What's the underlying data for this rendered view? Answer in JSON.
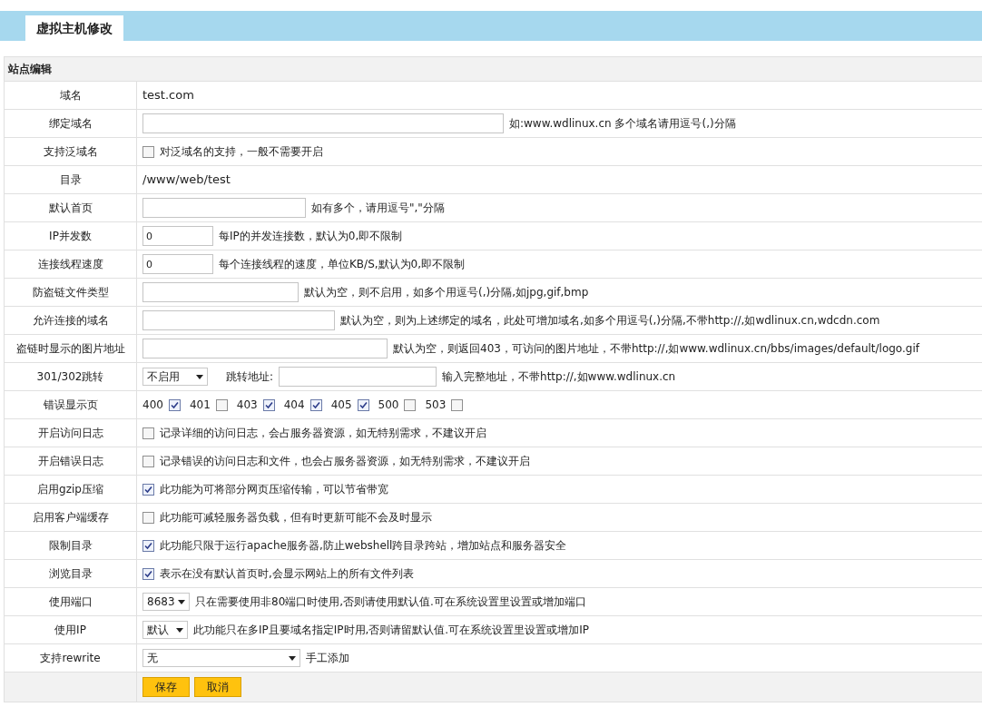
{
  "tab": {
    "label": "虚拟主机修改",
    "selected": true
  },
  "section": {
    "title": "站点编辑"
  },
  "rows": [
    {
      "kind": "text",
      "label": "域名",
      "value": "test.com"
    },
    {
      "kind": "input",
      "label": "绑定域名",
      "hint": "如:www.wdlinux.cn 多个域名请用逗号(,)分隔"
    },
    {
      "kind": "checkbox",
      "label": "支持泛域名",
      "checked": false,
      "hint": "对泛域名的支持，一般不需要开启"
    },
    {
      "kind": "text",
      "label": "目录",
      "value": "/www/web/test"
    },
    {
      "kind": "input",
      "label": "默认首页",
      "hint": "如有多个，请用逗号\",\"分隔"
    },
    {
      "kind": "input",
      "label": "IP并发数",
      "value": "0",
      "hint": "每IP的并发连接数，默认为0,即不限制"
    },
    {
      "kind": "input",
      "label": "连接线程速度",
      "value": "0",
      "hint": "每个连接线程的速度，单位KB/S,默认为0,即不限制"
    },
    {
      "kind": "input",
      "label": "防盗链文件类型",
      "hint": "默认为空，则不启用，如多个用逗号(,)分隔,如jpg,gif,bmp"
    },
    {
      "kind": "input",
      "label": "允许连接的域名",
      "hint": "默认为空，则为上述绑定的域名，此处可增加域名,如多个用逗号(,)分隔,不带http://,如wdlinux.cn,wdcdn.com"
    },
    {
      "kind": "input",
      "label": "盗链时显示的图片地址",
      "hint": "默认为空，则返回403，可访问的图片地址，不带http://,如www.wdlinux.cn/bbs/images/default/logo.gif"
    },
    {
      "kind": "redirect",
      "label": "301/302跳转",
      "select": "不启用",
      "address_label": "跳转地址:",
      "hint": "输入完整地址，不带http://,如www.wdlinux.cn"
    },
    {
      "kind": "codes",
      "label": "错误显示页",
      "codes": [
        {
          "code": "400",
          "checked": true
        },
        {
          "code": "401",
          "checked": false
        },
        {
          "code": "403",
          "checked": true
        },
        {
          "code": "404",
          "checked": true
        },
        {
          "code": "405",
          "checked": true
        },
        {
          "code": "500",
          "checked": false
        },
        {
          "code": "503",
          "checked": false
        }
      ]
    },
    {
      "kind": "checkbox",
      "label": "开启访问日志",
      "checked": false,
      "hint": "记录详细的访问日志，会占服务器资源，如无特别需求，不建议开启"
    },
    {
      "kind": "checkbox",
      "label": "开启错误日志",
      "checked": false,
      "hint": "记录错误的访问日志和文件，也会占服务器资源，如无特别需求，不建议开启"
    },
    {
      "kind": "checkbox",
      "label": "启用gzip压缩",
      "checked": true,
      "hint": "此功能为可将部分网页压缩传输，可以节省带宽"
    },
    {
      "kind": "checkbox",
      "label": "启用客户端缓存",
      "checked": false,
      "hint": "此功能可减轻服务器负载，但有时更新可能不会及时显示"
    },
    {
      "kind": "checkbox",
      "label": "限制目录",
      "checked": true,
      "hint": "此功能只限于运行apache服务器,防止webshell跨目录跨站，增加站点和服务器安全"
    },
    {
      "kind": "checkbox",
      "label": "浏览目录",
      "checked": true,
      "hint": "表示在没有默认首页时,会显示网站上的所有文件列表"
    },
    {
      "kind": "select",
      "label": "使用端口",
      "select": "8683",
      "hint": "只在需要使用非80端口时使用,否则请使用默认值.可在系统设置里设置或增加端口"
    },
    {
      "kind": "select",
      "label": "使用IP",
      "select": "默认",
      "hint": "此功能只在多IP且要域名指定IP时用,否则请留默认值.可在系统设置里设置或增加IP"
    },
    {
      "kind": "select",
      "label": "支持rewrite",
      "select": "无",
      "hint": "手工添加"
    }
  ],
  "buttons": [
    "保存",
    "取消"
  ]
}
